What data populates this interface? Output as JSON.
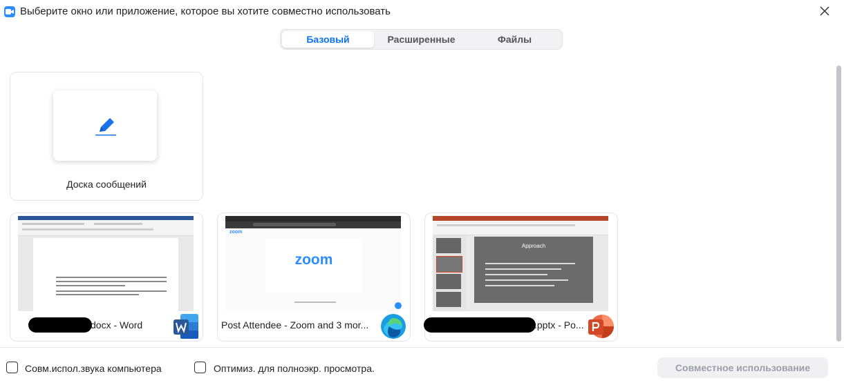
{
  "window": {
    "title": "Выберите окно или приложение, которое вы хотите совместно использовать",
    "icon": "zoom-video-icon",
    "close_icon": "close-icon"
  },
  "tabs": [
    {
      "label": "Базовый",
      "active": true
    },
    {
      "label": "Расширенные",
      "active": false
    },
    {
      "label": "Файлы",
      "active": false
    }
  ],
  "whiteboard": {
    "label": "Доска сообщений",
    "icon": "pen-icon"
  },
  "windows": [
    {
      "label": "docx - Word",
      "app_icon": "word-icon",
      "preview": "word-document"
    },
    {
      "label": "Post Attendee - Zoom and 3 mor...",
      "app_icon": "edge-icon",
      "preview": "browser-zoom-page",
      "preview_text": "zoom"
    },
    {
      "label": ".pptx - Po...",
      "app_icon": "powerpoint-icon",
      "preview": "powerpoint-slide",
      "preview_text": "Approach"
    }
  ],
  "footer": {
    "share_sound": {
      "label": "Совм.испол.звука компьютера",
      "checked": false
    },
    "optimize_video": {
      "label": "Оптимиз. для полноэкр. просмотра.",
      "checked": false
    },
    "share_button": "Совместное использование"
  },
  "colors": {
    "accent": "#0e71eb",
    "word": "#2b579a",
    "powerpoint": "#d24726",
    "edge": "#1b9de2"
  }
}
